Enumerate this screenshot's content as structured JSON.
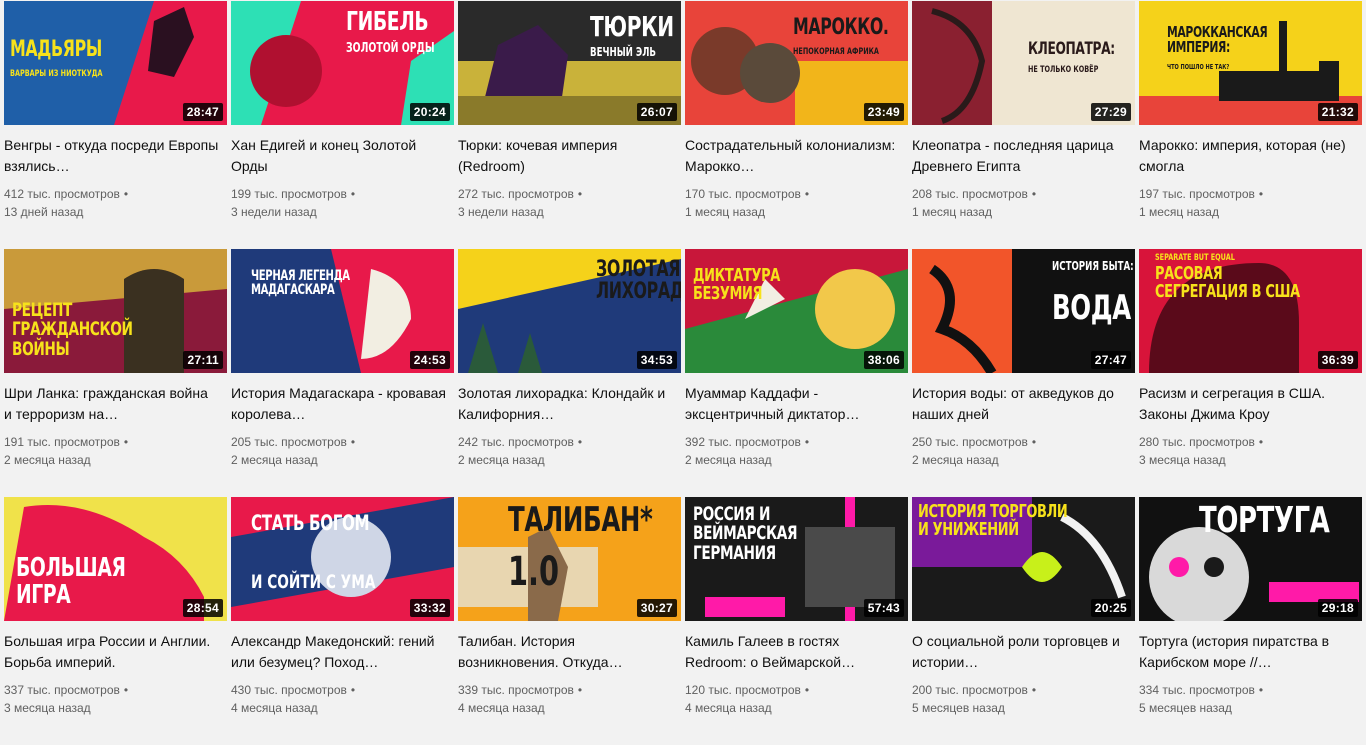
{
  "videos": [
    {
      "title": "Венгры - откуда посреди Европы взялись…",
      "views": "412 тыс. просмотров",
      "date": "13 дней назад",
      "duration": "28:47",
      "thumb_text": "Мадьяры",
      "thumb_sub": "варвары из ниоткуда",
      "colors": {
        "bg": "#e8194a",
        "accent": "#1f5fa8",
        "text": "#f7e21b"
      }
    },
    {
      "title": "Хан Едигей и конец Золотой Орды",
      "views": "199 тыс. просмотров",
      "date": "3 недели назад",
      "duration": "20:24",
      "thumb_text": "Гибель",
      "thumb_sub": "Золотой Орды",
      "colors": {
        "bg": "#e8194a",
        "accent": "#2de0b5",
        "text": "#ffffff"
      }
    },
    {
      "title": "Тюрки: кочевая империя (Redroom)",
      "views": "272 тыс. просмотров",
      "date": "3 недели назад",
      "duration": "26:07",
      "thumb_text": "Тюрки",
      "thumb_sub": "Вечный Эль",
      "colors": {
        "bg": "#c9b23a",
        "accent": "#3a1b4a",
        "text": "#ffffff"
      }
    },
    {
      "title": "Сострадательный колониализм: Марокко…",
      "views": "170 тыс. просмотров",
      "date": "1 месяц назад",
      "duration": "23:49",
      "thumb_text": "Марокко.",
      "thumb_sub": "непокорная Африка",
      "colors": {
        "bg": "#e8443a",
        "accent": "#f2b51a",
        "text": "#1a1a1a"
      }
    },
    {
      "title": "Клеопатра - последняя царица Древнего Египта",
      "views": "208 тыс. просмотров",
      "date": "1 месяц назад",
      "duration": "27:29",
      "thumb_text": "Клеопатра:",
      "thumb_sub": "не только ковёр",
      "colors": {
        "bg": "#efe6d2",
        "accent": "#8a2030",
        "text": "#2a1a1a"
      }
    },
    {
      "title": "Марокко: империя, которая (не) смогла",
      "views": "197 тыс. просмотров",
      "date": "1 месяц назад",
      "duration": "21:32",
      "thumb_text": "Марокканская империя:",
      "thumb_sub": "что пошло не так?",
      "colors": {
        "bg": "#f5d21a",
        "accent": "#e8443a",
        "text": "#1a1a1a"
      }
    },
    {
      "title": "Шри Ланка: гражданская война и терроризм на…",
      "views": "191 тыс. просмотров",
      "date": "2 месяца назад",
      "duration": "27:11",
      "thumb_text": "Рецепт гражданской войны",
      "thumb_sub": "",
      "colors": {
        "bg": "#8a1a3a",
        "accent": "#c99a3a",
        "text": "#f7e21b"
      }
    },
    {
      "title": "История Мадагаскара - кровавая королева…",
      "views": "205 тыс. просмотров",
      "date": "2 месяца назад",
      "duration": "24:53",
      "thumb_text": "Черная легенда Мадагаскара",
      "thumb_sub": "",
      "colors": {
        "bg": "#1f3a7a",
        "accent": "#e8194a",
        "text": "#ffffff"
      }
    },
    {
      "title": "Золотая лихорадка: Клондайк и Калифорния…",
      "views": "242 тыс. просмотров",
      "date": "2 месяца назад",
      "duration": "34:53",
      "thumb_text": "Золотая лихорадка",
      "thumb_sub": "",
      "colors": {
        "bg": "#f5d21a",
        "accent": "#1f3a7a",
        "text": "#1a1a1a"
      }
    },
    {
      "title": "Муаммар Каддафи - эксцентричный диктатор…",
      "views": "392 тыс. просмотров",
      "date": "2 месяца назад",
      "duration": "38:06",
      "thumb_text": "Диктатура безумия",
      "thumb_sub": "",
      "colors": {
        "bg": "#c8173a",
        "accent": "#2a8a3a",
        "text": "#f7e21b"
      }
    },
    {
      "title": "История воды: от акведуков до наших дней",
      "views": "250 тыс. просмотров",
      "date": "2 месяца назад",
      "duration": "27:47",
      "thumb_text": "Вода",
      "thumb_sub": "История быта:",
      "colors": {
        "bg": "#111111",
        "accent": "#f2552a",
        "text": "#ffffff"
      }
    },
    {
      "title": "Расизм и сегрегация в США. Законы Джима Кроу",
      "views": "280 тыс. просмотров",
      "date": "3 месяца назад",
      "duration": "36:39",
      "thumb_text": "Расовая сегрегация в США",
      "thumb_sub": "separate but equal",
      "colors": {
        "bg": "#d8143a",
        "accent": "#f7e21b",
        "text": "#f7e21b"
      }
    },
    {
      "title": "Большая игра России и Англии. Борьба империй.",
      "views": "337 тыс. просмотров",
      "date": "3 месяца назад",
      "duration": "28:54",
      "thumb_text": "Большая игра",
      "thumb_sub": "",
      "colors": {
        "bg": "#f0e24a",
        "accent": "#e8194a",
        "text": "#ffffff"
      }
    },
    {
      "title": "Александр Македонский: гений или безумец? Поход…",
      "views": "430 тыс. просмотров",
      "date": "4 месяца назад",
      "duration": "33:32",
      "thumb_text": "Стать богом",
      "thumb_sub": "и сойти с ума",
      "colors": {
        "bg": "#e8194a",
        "accent": "#1f3a7a",
        "text": "#ffffff"
      }
    },
    {
      "title": "Талибан. История возникновения. Откуда…",
      "views": "339 тыс. просмотров",
      "date": "4 месяца назад",
      "duration": "30:27",
      "thumb_text": "Талибан*",
      "thumb_sub": "1.0",
      "colors": {
        "bg": "#f5a21a",
        "accent": "#e8194a",
        "text": "#1a1a1a"
      }
    },
    {
      "title": "Камиль Галеев в гостях Redroom: о Веймарской…",
      "views": "120 тыс. просмотров",
      "date": "4 месяца назад",
      "duration": "57:43",
      "thumb_text": "Россия и Веймарская Германия",
      "thumb_sub": "",
      "colors": {
        "bg": "#1a1a1a",
        "accent": "#ff1aa8",
        "text": "#ffffff"
      }
    },
    {
      "title": "О социальной роли торговцев и истории…",
      "views": "200 тыс. просмотров",
      "date": "5 месяцев назад",
      "duration": "20:25",
      "thumb_text": "История торговли и унижений",
      "thumb_sub": "",
      "colors": {
        "bg": "#1a1a1a",
        "accent": "#c8f01a",
        "text": "#f7e21b"
      }
    },
    {
      "title": "Тортуга (история пиратства в Карибском море //…",
      "views": "334 тыс. просмотров",
      "date": "5 месяцев назад",
      "duration": "29:18",
      "thumb_text": "Тортуга",
      "thumb_sub": "",
      "colors": {
        "bg": "#111111",
        "accent": "#ff1aa8",
        "text": "#ffffff"
      }
    }
  ]
}
